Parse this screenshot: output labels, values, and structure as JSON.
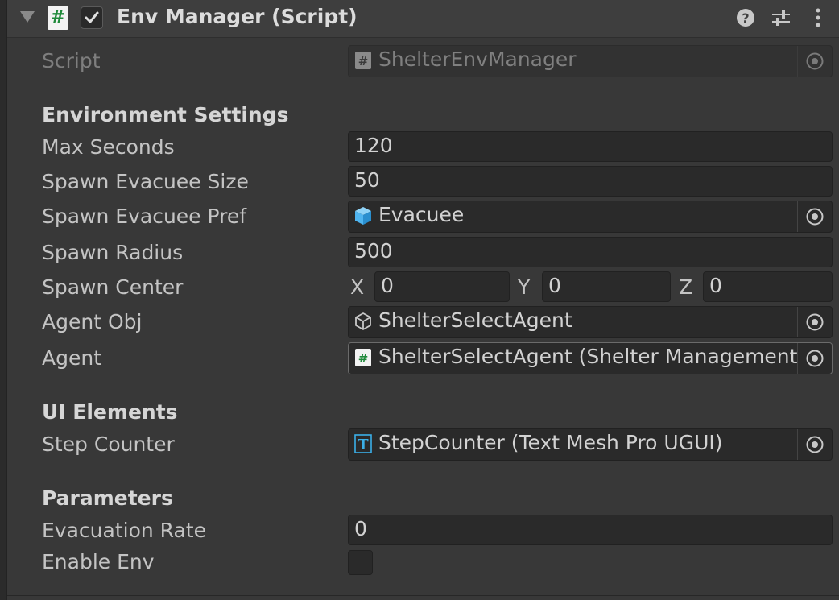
{
  "header": {
    "title": "Env Manager (Script)",
    "enabled": true
  },
  "script_field": {
    "label": "Script",
    "value": "ShelterEnvManager"
  },
  "environment_settings": {
    "heading": "Environment Settings",
    "max_seconds": {
      "label": "Max Seconds",
      "value": "120"
    },
    "spawn_evacuee_size": {
      "label": "Spawn Evacuee Size",
      "value": "50"
    },
    "spawn_evacuee_pref": {
      "label": "Spawn Evacuee Pref",
      "value": "Evacuee"
    },
    "spawn_radius": {
      "label": "Spawn Radius",
      "value": "500"
    },
    "spawn_center": {
      "label": "Spawn Center",
      "x_label": "X",
      "x": "0",
      "y_label": "Y",
      "y": "0",
      "z_label": "Z",
      "z": "0"
    },
    "agent_obj": {
      "label": "Agent Obj",
      "value": "ShelterSelectAgent"
    },
    "agent": {
      "label": "Agent",
      "value": "ShelterSelectAgent (Shelter Management)"
    }
  },
  "ui_elements": {
    "heading": "UI Elements",
    "step_counter": {
      "label": "Step Counter",
      "value": "StepCounter (Text Mesh Pro UGUI)"
    }
  },
  "parameters": {
    "heading": "Parameters",
    "evacuation_rate": {
      "label": "Evacuation Rate",
      "value": "0"
    },
    "enable_env": {
      "label": "Enable Env",
      "checked": false
    }
  },
  "icons": {
    "foldout": "foldout-arrow-icon",
    "script": "cs-script-icon",
    "enabled_check": "checkmark-icon",
    "help": "help-icon",
    "presets": "presets-sliders-icon",
    "menu": "kebab-menu-icon",
    "prefab": "prefab-cube-icon",
    "gameobject": "gameobject-cube-icon",
    "text": "textmeshpro-icon",
    "picker": "object-picker-icon"
  },
  "colors": {
    "background": "#383838",
    "header": "#3e3e3e",
    "field": "#2a2a2a",
    "text": "#c4c4c4",
    "prefab_blue": "#4fb4ef",
    "script_green": "#1f8a3a"
  }
}
